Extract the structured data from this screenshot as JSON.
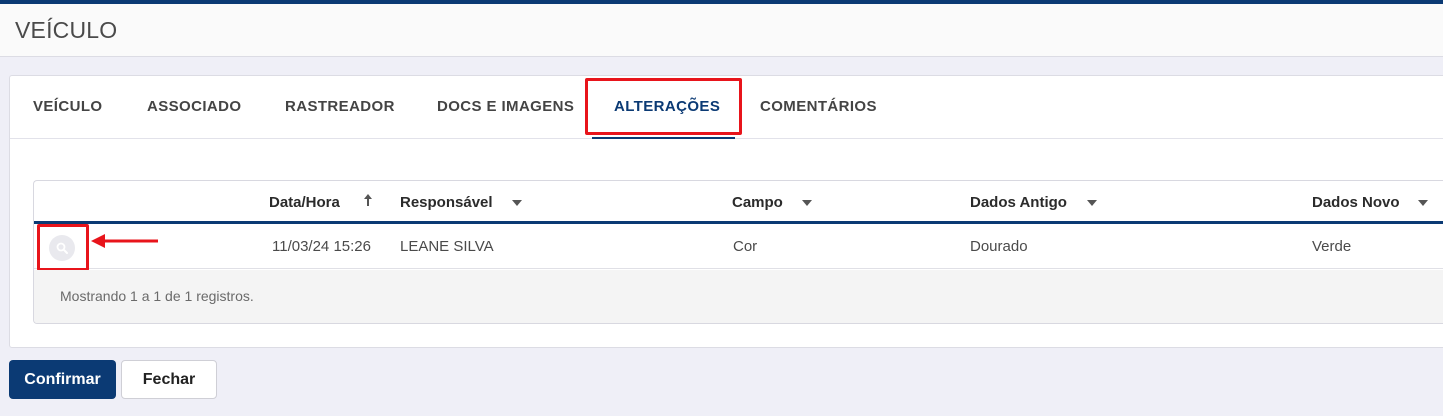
{
  "page": {
    "title": "VEÍCULO"
  },
  "tabs": [
    {
      "label": "VEÍCULO",
      "active": false
    },
    {
      "label": "ASSOCIADO",
      "active": false
    },
    {
      "label": "RASTREADOR",
      "active": false
    },
    {
      "label": "DOCS E IMAGENS",
      "active": false
    },
    {
      "label": "ALTERAÇÕES",
      "active": true
    },
    {
      "label": "COMENTÁRIOS",
      "active": false
    }
  ],
  "grid": {
    "columns": [
      {
        "label": "Data/Hora",
        "sort_icon": "arrow-up-icon"
      },
      {
        "label": "Responsável",
        "sort_icon": "caret-down-icon"
      },
      {
        "label": "Campo",
        "sort_icon": "caret-down-icon"
      },
      {
        "label": "Dados Antigo",
        "sort_icon": "caret-down-icon"
      },
      {
        "label": "Dados Novo",
        "sort_icon": "caret-down-icon"
      }
    ],
    "rows": [
      {
        "datetime": "11/03/24 15:26",
        "responsible": "LEANE SILVA",
        "field": "Cor",
        "old_value": "Dourado",
        "new_value": "Verde"
      }
    ],
    "footer": "Mostrando 1 a 1 de 1 registros."
  },
  "actions": {
    "confirm_label": "Confirmar",
    "close_label": "Fechar"
  },
  "colors": {
    "primary": "#0b3a74",
    "highlight": "#e8141b",
    "background": "#efeff7"
  },
  "icons": {
    "row_action": "search-icon",
    "annotation": "red-arrow-icon"
  }
}
